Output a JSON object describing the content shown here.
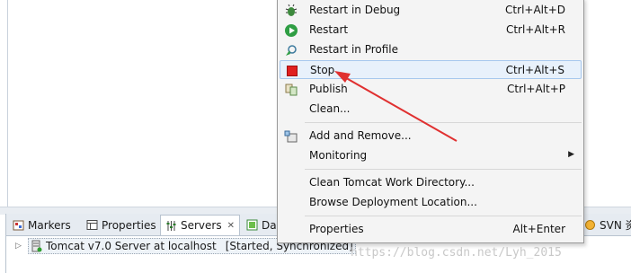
{
  "menu": {
    "items": [
      {
        "label": "Restart in Debug",
        "accel": "Ctrl+Alt+D",
        "icon": "debug-bug-icon"
      },
      {
        "label": "Restart",
        "accel": "Ctrl+Alt+R",
        "icon": "run-restart-icon"
      },
      {
        "label": "Restart in Profile",
        "accel": "",
        "icon": "profile-icon"
      },
      {
        "label": "Stop",
        "accel": "Ctrl+Alt+S",
        "icon": "stop-icon"
      },
      {
        "label": "Publish",
        "accel": "Ctrl+Alt+P",
        "icon": "publish-icon"
      },
      {
        "label": "Clean...",
        "accel": "",
        "icon": ""
      },
      {
        "label": "Add and Remove...",
        "accel": "",
        "icon": "add-remove-icon"
      },
      {
        "label": "Monitoring",
        "accel": "",
        "icon": ""
      },
      {
        "label": "Clean Tomcat Work Directory...",
        "accel": "",
        "icon": ""
      },
      {
        "label": "Browse Deployment Location...",
        "accel": "",
        "icon": ""
      },
      {
        "label": "Properties",
        "accel": "Alt+Enter",
        "icon": ""
      }
    ],
    "colors": {
      "stop": "#e02020",
      "highlight": "#e8f1fb",
      "annotation_arrow": "#e03030"
    }
  },
  "tabs": [
    {
      "label": "Markers",
      "icon": "markers-icon"
    },
    {
      "label": "Properties",
      "icon": "properties-icon"
    },
    {
      "label": "Servers",
      "icon": "servers-icon"
    },
    {
      "label": "Da",
      "icon": "data-source-icon"
    },
    {
      "label": "SVN 资",
      "icon": "svn-icon"
    }
  ],
  "server_row": {
    "name": "Tomcat v7.0 Server at localhost",
    "state": "[Started, Synchronized]"
  },
  "watermark": "https://blog.csdn.net/Lyh_2015"
}
